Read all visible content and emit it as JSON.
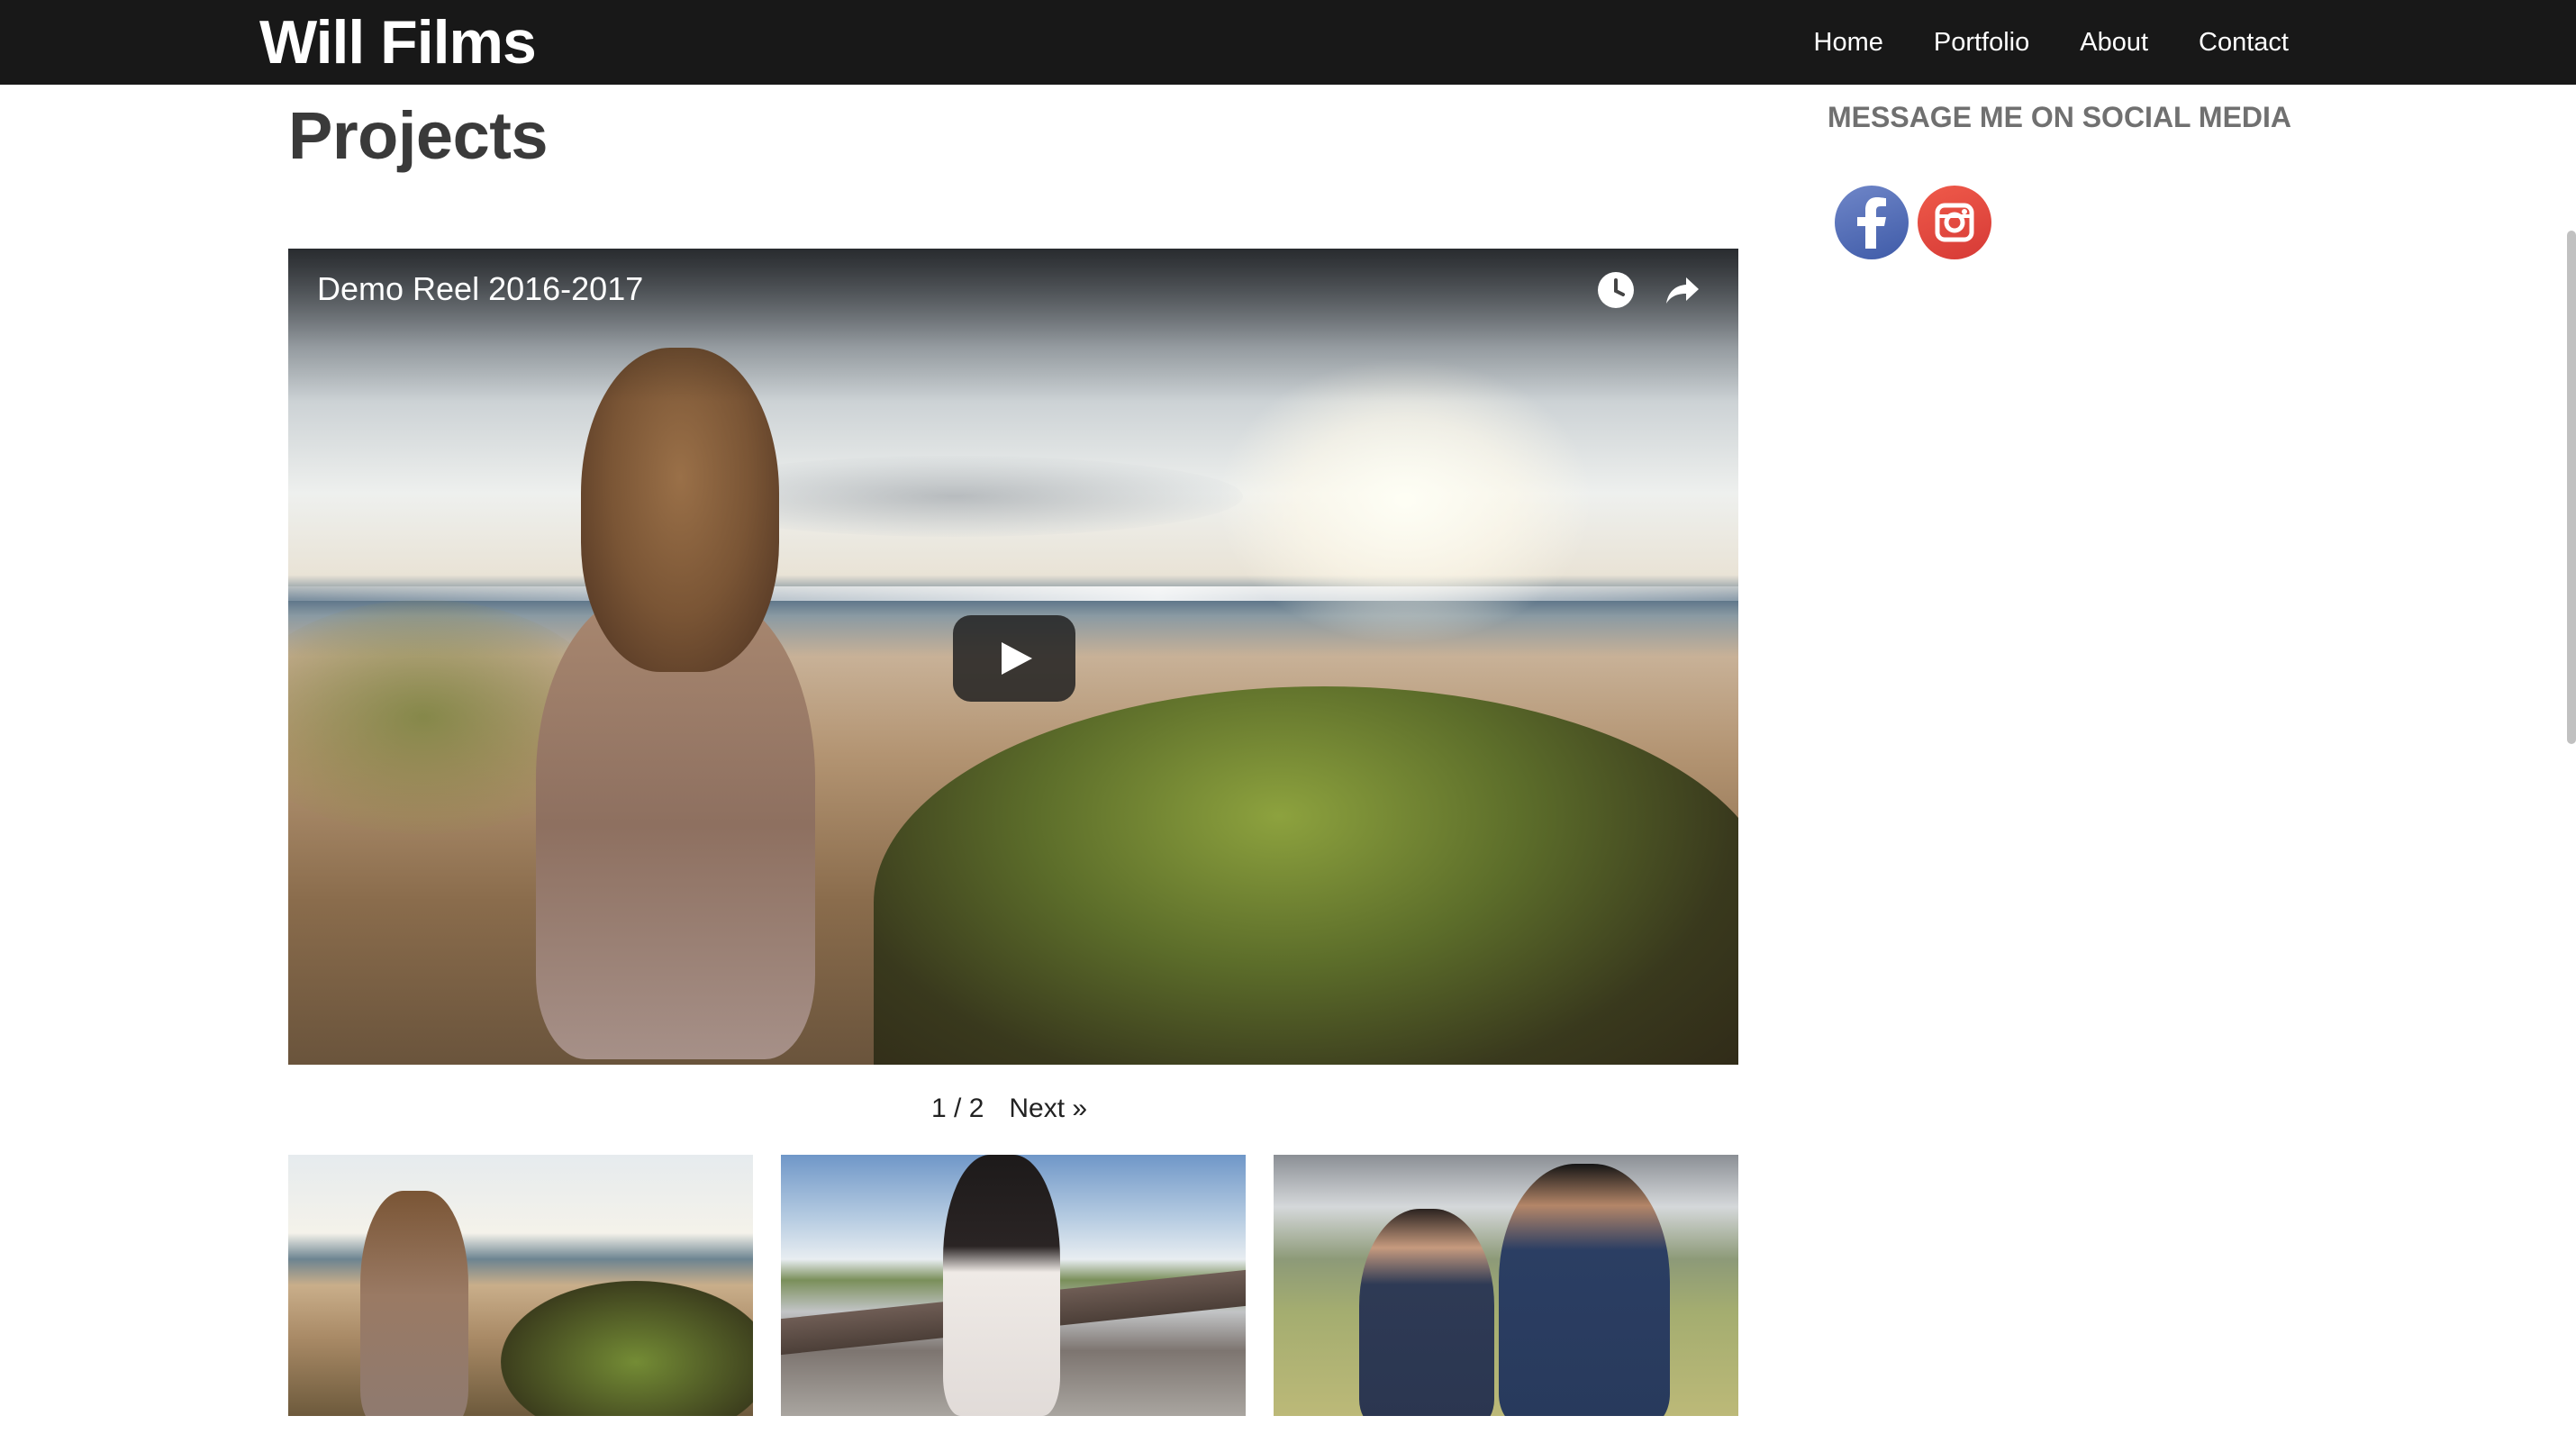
{
  "header": {
    "logo": "Will Films",
    "nav": [
      "Home",
      "Portfolio",
      "About",
      "Contact"
    ]
  },
  "main": {
    "title": "Projects",
    "video": {
      "title": "Demo Reel 2016-2017",
      "icons": [
        "watch-later-icon",
        "share-icon",
        "play-icon"
      ]
    },
    "pagination": {
      "current": "1 / 2",
      "next": "Next »"
    },
    "thumbnails": [
      "beach-walk-thumbnail",
      "railing-portrait-thumbnail",
      "couple-portrait-thumbnail"
    ]
  },
  "sidebar": {
    "heading": "MESSAGE ME ON SOCIAL MEDIA",
    "social": [
      "facebook-icon",
      "instagram-icon"
    ],
    "colors": {
      "facebook": "#3f5ba8",
      "instagram": "#d63a36"
    }
  },
  "colors": {
    "topbar": "#181818",
    "title": "#3a3a3a",
    "sidebar_heading": "#707070"
  }
}
